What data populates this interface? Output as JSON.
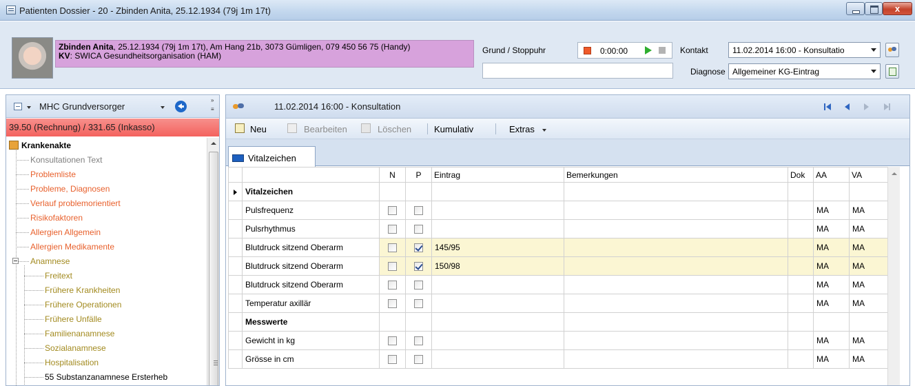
{
  "window": {
    "title": "Patienten Dossier - 20 - Zbinden Anita, 25.12.1934 (79j 1m 17t)"
  },
  "patient": {
    "name": "Zbinden Anita",
    "details": ", 25.12.1934 (79j 1m 17t), Am Hang 21b, 3073 Gümligen, 079 450 56 75 (Handy)",
    "kv_label": "KV",
    "kv_value": ": SWICA Gesundheitsorganisation (HAM)",
    "info_color": "#d7a2dc"
  },
  "header": {
    "grund_label": "Grund / Stoppuhr",
    "grund_value": "",
    "stopwatch_time": "0:00:00",
    "kontakt_label": "Kontakt",
    "kontakt_value": "11.02.2014 16:00 - Konsultatio",
    "diagnose_label": "Diagnose",
    "diagnose_value": "Allgemeiner KG-Eintrag"
  },
  "left": {
    "view_label": "MHC Grundversorger",
    "invoice_text": "39.50 (Rechnung) / 331.65 (Inkasso)",
    "invoice_color": "#f4625e",
    "tree": [
      {
        "label": "Krankenakte",
        "level": 0,
        "color": "#000000",
        "bold": true
      },
      {
        "label": "Konsultationen Text",
        "level": 1,
        "color": "#808080"
      },
      {
        "label": "Problemliste",
        "level": 1,
        "color": "#e8602c"
      },
      {
        "label": "Probleme, Diagnosen",
        "level": 1,
        "color": "#e8602c"
      },
      {
        "label": "Verlauf problemorientiert",
        "level": 1,
        "color": "#e8602c"
      },
      {
        "label": "Risikofaktoren",
        "level": 1,
        "color": "#e8602c"
      },
      {
        "label": "Allergien Allgemein",
        "level": 1,
        "color": "#e8602c"
      },
      {
        "label": "Allergien Medikamente",
        "level": 1,
        "color": "#e8602c"
      },
      {
        "label": "Anamnese",
        "level": 1,
        "color": "#a28a1f"
      },
      {
        "label": "Freitext",
        "level": 2,
        "color": "#a28a1f"
      },
      {
        "label": "Frühere Krankheiten",
        "level": 2,
        "color": "#a28a1f"
      },
      {
        "label": "Frühere Operationen",
        "level": 2,
        "color": "#a28a1f"
      },
      {
        "label": "Frühere Unfälle",
        "level": 2,
        "color": "#a28a1f"
      },
      {
        "label": "Familienanamnese",
        "level": 2,
        "color": "#a28a1f"
      },
      {
        "label": "Sozialanamnese",
        "level": 2,
        "color": "#a28a1f"
      },
      {
        "label": "Hospitalisation",
        "level": 2,
        "color": "#a28a1f"
      },
      {
        "label": "55 Substanzanamnese Ersterheb",
        "level": 2,
        "color": "#000000"
      }
    ]
  },
  "right": {
    "title": "11.02.2014 16:00 - Konsultation",
    "toolbar": {
      "neu": "Neu",
      "bearbeiten": "Bearbeiten",
      "loeschen": "Löschen",
      "kumulativ": "Kumulativ",
      "extras": "Extras"
    },
    "tab": "Vitalzeichen",
    "columns": {
      "n": "N",
      "p": "P",
      "eintrag": "Eintrag",
      "bemerkungen": "Bemerkungen",
      "dok": "Dok",
      "aa": "AA",
      "va": "VA"
    },
    "highlight_color": "#fbf6d3",
    "rows": [
      {
        "label": "Vitalzeichen",
        "group": true,
        "current": true,
        "n": null,
        "p": null,
        "eintrag": "",
        "aa": "",
        "va": ""
      },
      {
        "label": "Pulsfrequenz",
        "group": false,
        "n": false,
        "p": false,
        "eintrag": "",
        "aa": "MA",
        "va": "MA"
      },
      {
        "label": "Pulsrhythmus",
        "group": false,
        "n": false,
        "p": false,
        "eintrag": "",
        "aa": "MA",
        "va": "MA"
      },
      {
        "label": "Blutdruck sitzend Oberarm",
        "group": false,
        "hl": true,
        "n": false,
        "p": true,
        "eintrag": "145/95",
        "aa": "MA",
        "va": "MA"
      },
      {
        "label": "Blutdruck sitzend Oberarm",
        "group": false,
        "hl": true,
        "n": false,
        "p": true,
        "eintrag": "150/98",
        "aa": "MA",
        "va": "MA"
      },
      {
        "label": "Blutdruck sitzend Oberarm",
        "group": false,
        "n": false,
        "p": false,
        "eintrag": "",
        "aa": "MA",
        "va": "MA"
      },
      {
        "label": "Temperatur axillär",
        "group": false,
        "n": false,
        "p": false,
        "eintrag": "",
        "aa": "MA",
        "va": "MA"
      },
      {
        "label": "Messwerte",
        "group": true,
        "n": null,
        "p": null,
        "eintrag": "",
        "aa": "",
        "va": ""
      },
      {
        "label": "Gewicht in kg",
        "group": false,
        "n": false,
        "p": false,
        "eintrag": "",
        "aa": "MA",
        "va": "MA"
      },
      {
        "label": "Grösse in cm",
        "group": false,
        "n": false,
        "p": false,
        "eintrag": "",
        "aa": "MA",
        "va": "MA"
      }
    ]
  }
}
